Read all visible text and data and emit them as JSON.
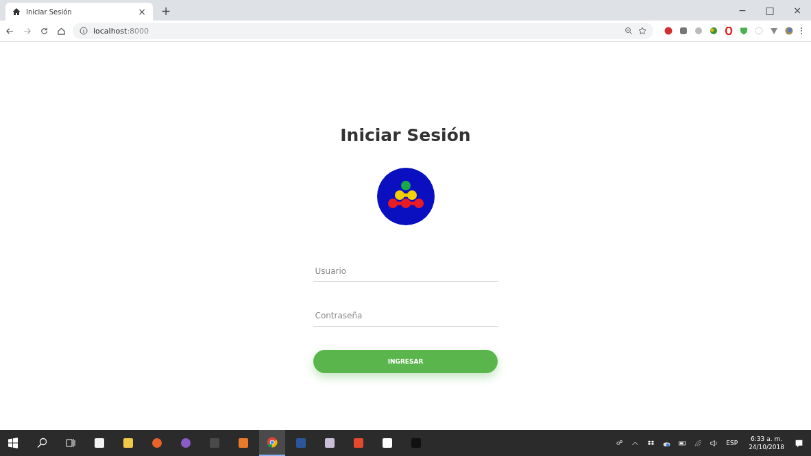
{
  "browser": {
    "tab": {
      "title": "Iniciar Sesión",
      "close": "×"
    },
    "new_tab": "+",
    "window_controls": [
      "−",
      "□",
      "×"
    ],
    "address": {
      "host": "localhost",
      "port": ":8000"
    }
  },
  "page": {
    "title": "Iniciar Sesión",
    "fields": [
      {
        "placeholder": "Usuario"
      },
      {
        "placeholder": "Contraseña"
      }
    ],
    "button": "INGRESAR"
  },
  "taskbar": {
    "apps": [
      {
        "kind": "start",
        "selected": false
      },
      {
        "kind": "search",
        "selected": false
      },
      {
        "kind": "taskview",
        "selected": false
      },
      {
        "kind": "store",
        "selected": false
      },
      {
        "kind": "folder",
        "selected": false
      },
      {
        "kind": "firefox",
        "selected": false
      },
      {
        "kind": "github",
        "selected": false
      },
      {
        "kind": "sublime",
        "selected": false
      },
      {
        "kind": "xampp",
        "selected": false
      },
      {
        "kind": "chrome",
        "selected": true
      },
      {
        "kind": "word",
        "selected": false
      },
      {
        "kind": "paint",
        "selected": false
      },
      {
        "kind": "acrobat",
        "selected": false
      },
      {
        "kind": "dropbox",
        "selected": false
      },
      {
        "kind": "terminal",
        "selected": false
      }
    ],
    "language": "ESP",
    "time": "6:33 a. m.",
    "date": "24/10/2018"
  }
}
